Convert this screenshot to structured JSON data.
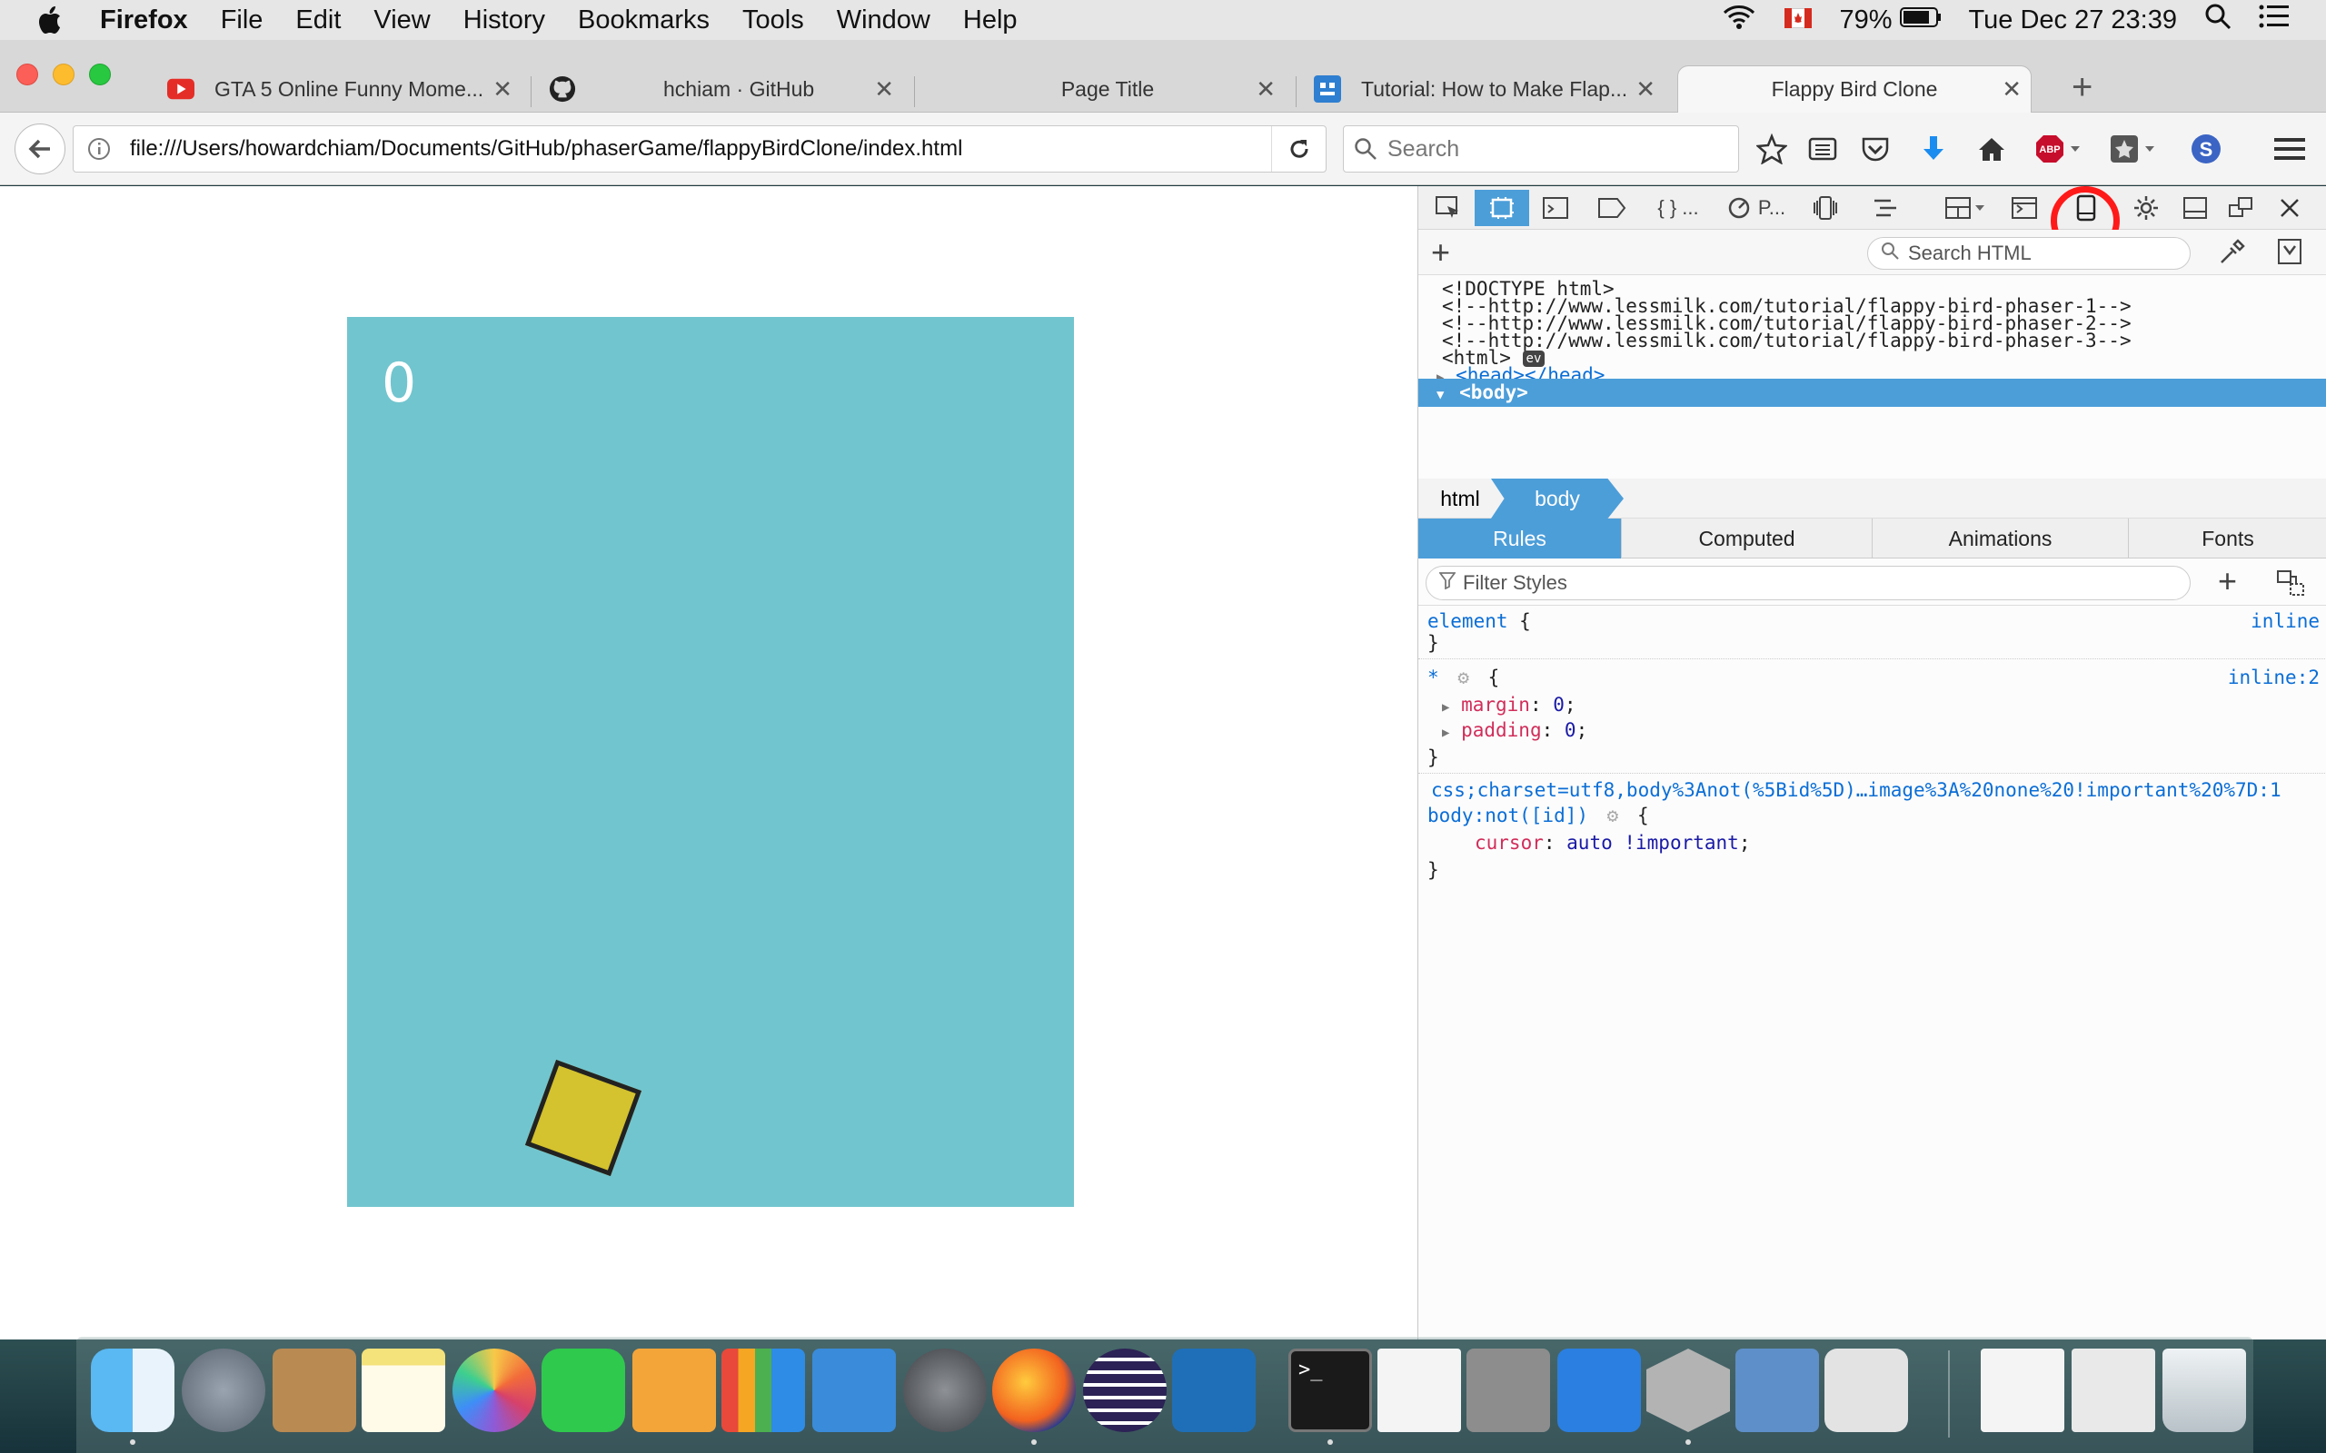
{
  "menubar": {
    "app": "Firefox",
    "items": [
      "File",
      "Edit",
      "View",
      "History",
      "Bookmarks",
      "Tools",
      "Window",
      "Help"
    ],
    "battery": "79%",
    "datetime": "Tue Dec 27  23:39"
  },
  "tabs": [
    {
      "title": "GTA 5 Online Funny Mome...",
      "favicon": "youtube-icon"
    },
    {
      "title": "hchiam · GitHub",
      "favicon": "github-icon"
    },
    {
      "title": "Page Title",
      "favicon": ""
    },
    {
      "title": "Tutorial: How to Make Flap...",
      "favicon": "lessmilk-icon"
    },
    {
      "title": "Flappy Bird Clone",
      "favicon": ""
    }
  ],
  "nav": {
    "url": "file:///Users/howardchiam/Documents/GitHub/phaserGame/flappyBirdClone/index.html",
    "search_placeholder": "Search"
  },
  "game": {
    "score": "0",
    "background": "#71c5cf",
    "bird_color": "#d4c22e"
  },
  "devtools": {
    "toolbar": {
      "debugger_label": "{ } ...",
      "perf_label": "P..."
    },
    "search_html_placeholder": "Search HTML",
    "markup": {
      "doctype": "<!DOCTYPE html>",
      "comment1": "<!--http://www.lessmilk.com/tutorial/flappy-bird-phaser-1-->",
      "comment2": "<!--http://www.lessmilk.com/tutorial/flappy-bird-phaser-2-->",
      "comment3": "<!--http://www.lessmilk.com/tutorial/flappy-bird-phaser-3-->",
      "html_open": "<html>",
      "ev_badge": "ev",
      "head": "<head></head>",
      "body": "<body>"
    },
    "breadcrumbs": [
      "html",
      "body"
    ],
    "sidebar_tabs": [
      "Rules",
      "Computed",
      "Animations",
      "Fonts"
    ],
    "filter_placeholder": "Filter Styles",
    "rules": {
      "element_selector": "element",
      "element_open": " {",
      "element_source": "inline",
      "close": "}",
      "star_selector": "*",
      "star_source": "inline:2",
      "margin_prop": "margin",
      "margin_val": "0",
      "padding_prop": "padding",
      "padding_val": "0",
      "data_source": "css;charset=utf8,body%3Anot(%5Bid%5D)…image%3A%20none%20!important%20%7D:1",
      "body_selector": "body:not([id])",
      "cursor_prop": "cursor",
      "cursor_val": "auto !important"
    }
  },
  "colors": {
    "accent": "#4c9ed9",
    "ring": "#ff1a1a"
  }
}
